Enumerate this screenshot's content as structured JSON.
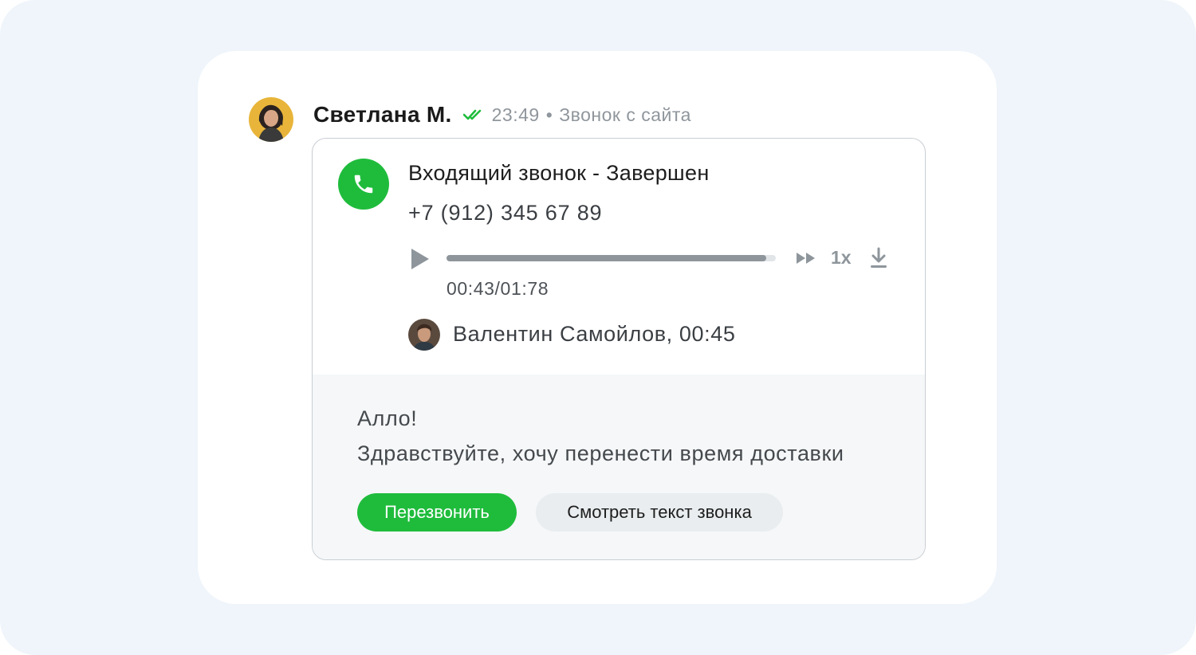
{
  "message": {
    "sender_name": "Светлана М.",
    "time": "23:49",
    "separator": "•",
    "source": "Звонок с сайта",
    "sender_avatar": "avatar-woman"
  },
  "call": {
    "icon": "phone-icon",
    "title": "Входящий звонок - Завершен",
    "phone": "+7 (912) 345 67 89",
    "player": {
      "progress_fraction": 0.97,
      "speed_label": "1x",
      "time_label": "00:43/01:78"
    },
    "agent": {
      "avatar": "avatar-man",
      "label": "Валентин Самойлов, 00:45"
    }
  },
  "transcript": {
    "lines": [
      "Алло!",
      "Здравствуйте, хочу перенести время доставки"
    ]
  },
  "actions": {
    "callback_label": "Перезвонить",
    "view_text_label": "Смотреть текст звонка"
  },
  "colors": {
    "accent_green": "#1fbc3c",
    "muted_gray": "#8e969c",
    "background": "#eff5fa"
  }
}
